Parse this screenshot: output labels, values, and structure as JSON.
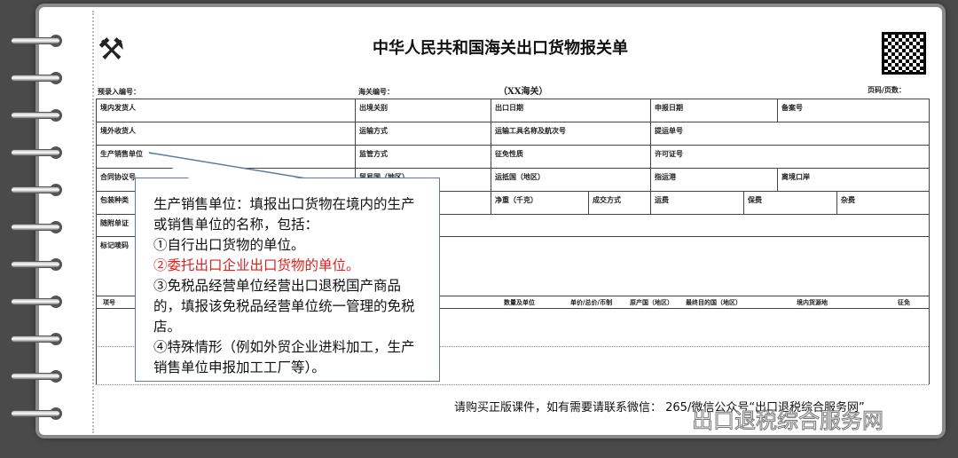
{
  "title": "中华人民共和国海关出口货物报关单",
  "header": {
    "pre_entry": "预录入编号：",
    "customs_no": "海关编号：",
    "customs": "（XX海关）",
    "page": "页码/页数："
  },
  "fields": {
    "domestic_shipper": "境内发货人",
    "exit_port": "出境关别",
    "export_date": "出口日期",
    "declare_date": "申报日期",
    "record_no": "备案号",
    "overseas_consignee": "境外收货人",
    "transport_mode": "运输方式",
    "vessel": "运输工具名称及航次号",
    "bl_no": "提运单号",
    "producer": "生产销售单位",
    "supervision": "监管方式",
    "tax_nature": "征免性质",
    "license": "许可证号",
    "contract": "合同协议号",
    "trade_country": "贸易国（地区）",
    "dest_country": "运抵国（地区）",
    "dest_port": "指运港",
    "depart_port": "离境口岸",
    "packing": "包装种类",
    "net_weight": "净重（千克）",
    "terms": "成交方式",
    "freight": "运费",
    "insurance": "保费",
    "misc": "杂费",
    "documents": "随附单证",
    "marks": "标记唛码"
  },
  "goods_header": [
    "项号",
    "数量及单位",
    "单价/总价/币制",
    "原产国（地区）",
    "最终目的国（地区）",
    "境内货源地",
    "征免"
  ],
  "callout": {
    "line1": "生产销售单位：填报出口货物在境内的生产或销售单位的名称，包括：",
    "item1": "①自行出口货物的单位。",
    "item2": "②委托出口企业出口货物的单位。",
    "item3": "③免税品经营单位经营出口退税国产商品的，填报该免税品经营单位统一管理的免税店。",
    "item4": "④特殊情形（例如外贸企业进料加工，生产销售单位申报加工工厂等）。"
  },
  "footer": "请购买正版课件，如有需要请联系微信：  265/微信公众号“出口退税综合服务网”",
  "watermark": "出口退税综合服务网",
  "colors": {
    "highlight": "#e02020",
    "callout_border": "#5a7ba8"
  }
}
